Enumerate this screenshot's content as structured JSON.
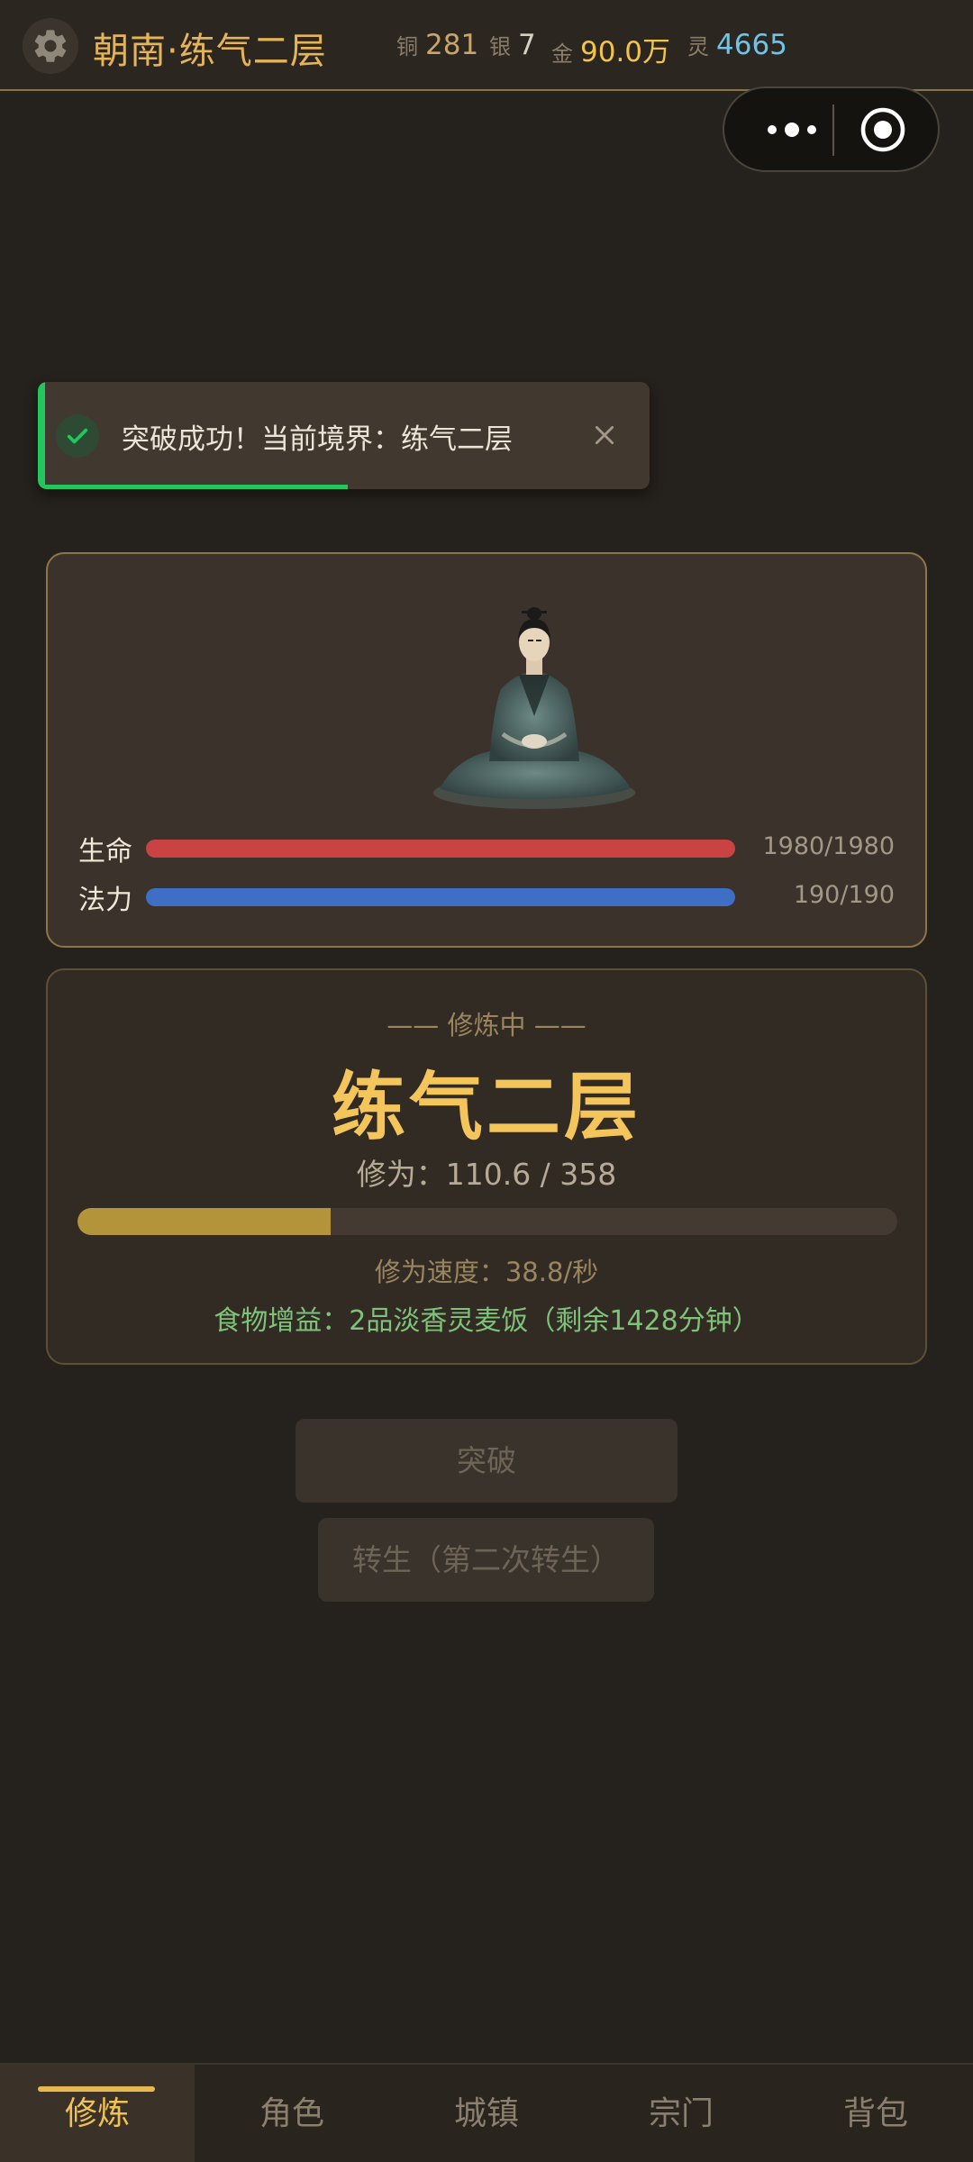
{
  "header": {
    "title": "朝南·练气二层",
    "resources": [
      {
        "label": "铜",
        "value": "281"
      },
      {
        "label": "银",
        "value": "7"
      },
      {
        "label": "金",
        "value": "90.0万"
      },
      {
        "label": "灵",
        "value": "4665"
      }
    ]
  },
  "toast": {
    "message": "突破成功！当前境界：练气二层",
    "remaining_fraction": 0.5
  },
  "character": {
    "stats": [
      {
        "label": "生命",
        "value": "1980/1980",
        "fraction": 1.0,
        "color": "#c94343"
      },
      {
        "label": "法力",
        "value": "190/190",
        "fraction": 1.0,
        "color": "#3e6fc4"
      }
    ]
  },
  "cultivation": {
    "status": "—— 修炼中 ——",
    "realm": "练气二层",
    "progress_text": "修为：110.6 / 358",
    "progress_current": 110.6,
    "progress_max": 358,
    "speed_text": "修为速度：38.8/秒",
    "food_buff_text": "食物增益：2品淡香灵麦饭（剩余1428分钟）"
  },
  "actions": {
    "breakthrough_label": "突破",
    "rebirth_label": "转生（第二次转生）"
  },
  "nav": {
    "items": [
      "修炼",
      "角色",
      "城镇",
      "宗门",
      "背包"
    ],
    "active_index": 0
  },
  "icons": {
    "settings": "gear-icon",
    "more": "more-dots-icon",
    "close_miniprogram": "target-circle-icon",
    "success": "check-icon",
    "dismiss": "close-icon"
  },
  "colors": {
    "accent": "#f4c55a",
    "success": "#22c55e",
    "food": "#7fc27a"
  }
}
